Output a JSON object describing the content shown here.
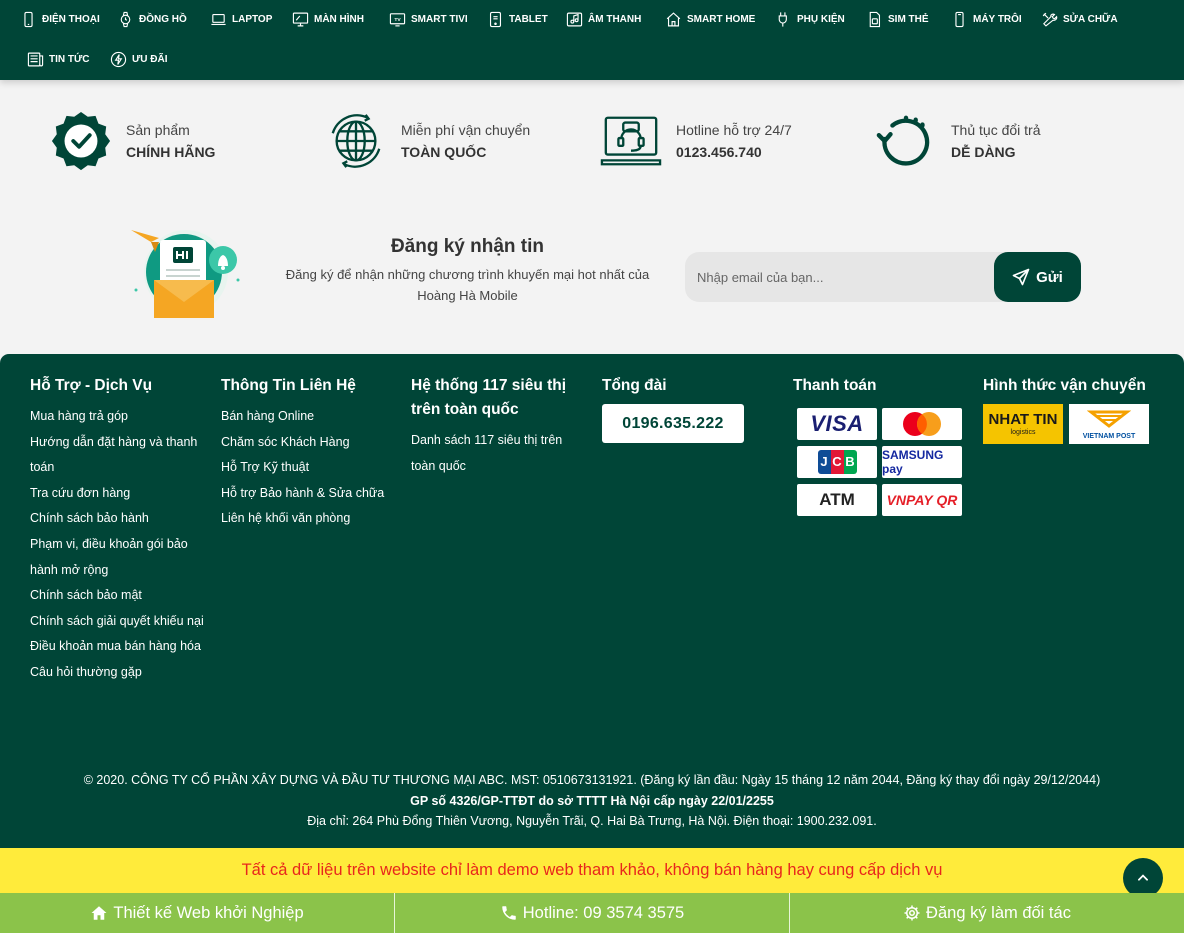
{
  "nav": {
    "items": [
      {
        "label": "ĐIỆN THOẠI",
        "icon": "phone-icon"
      },
      {
        "label": "ĐỒNG HỒ",
        "icon": "watch-icon"
      },
      {
        "label": "LAPTOP",
        "icon": "laptop-icon"
      },
      {
        "label": "MÀN HÌNH",
        "icon": "monitor-icon"
      },
      {
        "label": "SMART TIVI",
        "icon": "tv-icon"
      },
      {
        "label": "TABLET",
        "icon": "tablet-icon"
      },
      {
        "label": "ÂM THANH",
        "icon": "audio-icon"
      },
      {
        "label": "SMART HOME",
        "icon": "smart-home-icon"
      },
      {
        "label": "PHỤ KIỆN",
        "icon": "accessory-icon"
      },
      {
        "label": "SIM THẺ",
        "icon": "sim-icon"
      },
      {
        "label": "MÁY TRÔI",
        "icon": "used-phone-icon"
      },
      {
        "label": "SỬA CHỮA",
        "icon": "repair-icon"
      },
      {
        "label": "TIN TỨC",
        "icon": "news-icon"
      },
      {
        "label": "ƯU ĐÃI",
        "icon": "bolt-icon"
      }
    ]
  },
  "features": [
    {
      "line1": "Sản phẩm",
      "line2": "CHÍNH HÃNG",
      "icon": "badge-check-icon"
    },
    {
      "line1": "Miễn phí vận chuyển",
      "line2": "TOÀN QUỐC",
      "icon": "globe-icon"
    },
    {
      "line1": "Hotline hỗ trợ 24/7",
      "line2": "0123.456.740",
      "icon": "support-laptop-icon"
    },
    {
      "line1": "Thủ tục đổi trả",
      "line2": "DỄ DÀNG",
      "icon": "return-icon"
    }
  ],
  "newsletter": {
    "title": "Đăng ký nhận tin",
    "description": "Đăng ký để nhận những chương trình khuyến mại hot nhất của Hoàng Hà Mobile",
    "placeholder": "Nhập email của bạn...",
    "button_label": "Gửi"
  },
  "footer": {
    "support": {
      "title": "Hỗ Trợ - Dịch Vụ",
      "links": [
        "Mua hàng trả góp",
        "Hướng dẫn đặt hàng và thanh toán",
        "Tra cứu đơn hàng",
        "Chính sách bảo hành",
        "Phạm vi, điều khoản gói bảo hành mở rộng",
        "Chính sách bảo mật",
        "Chính sách giải quyết khiếu nại",
        "Điều khoản mua bán hàng hóa",
        "Câu hỏi thường gặp"
      ]
    },
    "contact": {
      "title": "Thông Tin Liên Hệ",
      "links": [
        "Bán hàng Online",
        "Chăm sóc Khách Hàng",
        "Hỗ Trợ Kỹ thuật",
        "Hỗ trợ Bảo hành & Sửa chữa",
        "Liên hệ khối văn phòng"
      ]
    },
    "stores": {
      "title": "Hệ thống 117 siêu thị trên toàn quốc",
      "links": [
        "Danh sách 117 siêu thị trên toàn quốc"
      ]
    },
    "switchboard": {
      "title": "Tổng đài",
      "number": "0196.635.222"
    },
    "payment": {
      "title": "Thanh toán",
      "methods": [
        {
          "label": "VISA",
          "icon": "visa-logo"
        },
        {
          "label": "",
          "icon": "mastercard-logo"
        },
        {
          "label": "JCB",
          "icon": "jcb-logo"
        },
        {
          "label": "SAMSUNG pay",
          "icon": "samsung-pay-logo"
        },
        {
          "label": "ATM",
          "icon": "atm-logo"
        },
        {
          "label": "VNPAY QR",
          "icon": "vnpay-logo"
        }
      ]
    },
    "shipping": {
      "title": "Hình thức vận chuyển",
      "methods": [
        {
          "label": "NHAT TIN",
          "sub": "logistics",
          "icon": "nhat-tin-logo"
        },
        {
          "label": "VIETNAM POST",
          "icon": "vietnam-post-logo"
        }
      ]
    },
    "copyright": {
      "line1": "© 2020. CÔNG TY CỔ PHẦN XÂY DỰNG VÀ ĐẦU TƯ THƯƠNG MẠI ABC. MST: 0510673131921. (Đăng ký lần đầu: Ngày 15 tháng 12 năm 2044, Đăng ký thay đổi ngày 29/12/2044)",
      "line2": "GP số 4326/GP-TTĐT do sở TTTT Hà Nội cấp ngày 22/01/2255",
      "line3": "Địa chỉ: 264 Phù Đổng Thiên Vương, Nguyễn Trãi, Q. Hai Bà Trưng, Hà Nội. Điện thoại: 1900.232.091."
    }
  },
  "demo_notice": "Tất cả dữ liệu trên website chỉ làm demo web tham khảo, không bán hàng hay cung cấp dịch vụ",
  "bottom_bar": [
    {
      "label": "Thiết kế Web khởi Nghiệp",
      "icon": "home-icon"
    },
    {
      "label": "Hotline: 09 3574 3575",
      "icon": "phone-handset-icon"
    },
    {
      "label": "Đăng ký làm đối tác",
      "icon": "gear-icon"
    }
  ],
  "colors": {
    "brand": "#004537",
    "demo_bar_bg": "#ffeb3b",
    "demo_bar_text": "#e8271c",
    "bottom_bar_bg": "#8bc34a"
  }
}
